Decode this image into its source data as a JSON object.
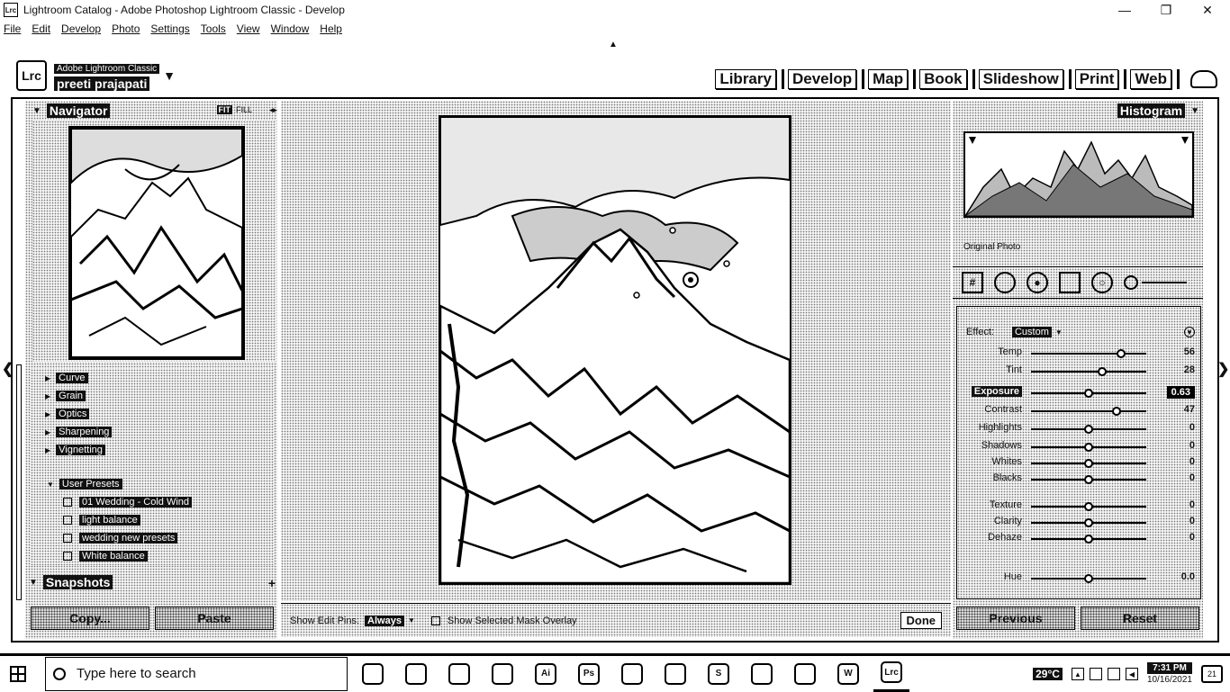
{
  "window": {
    "title": "Lightroom Catalog - Adobe Photoshop Lightroom Classic - Develop",
    "app_icon": "Lrc",
    "controls": {
      "minimize": "—",
      "maximize": "❐",
      "close": "✕"
    }
  },
  "menu": [
    "File",
    "Edit",
    "Develop",
    "Photo",
    "Settings",
    "Tools",
    "View",
    "Window",
    "Help"
  ],
  "identity": {
    "badge": "Lrc",
    "product": "Adobe Lightroom Classic",
    "user": "preeti prajapati"
  },
  "modules": [
    "Library",
    "Develop",
    "Map",
    "Book",
    "Slideshow",
    "Print",
    "Web"
  ],
  "left_panel": {
    "navigator": {
      "title": "Navigator",
      "fit": "FIT",
      "fill": "FILL"
    },
    "preset_groups": [
      {
        "label": "Curve"
      },
      {
        "label": "Grain"
      },
      {
        "label": "Optics"
      },
      {
        "label": "Sharpening"
      },
      {
        "label": "Vignetting"
      }
    ],
    "user_presets": {
      "label": "User Presets",
      "items": [
        "01 Wedding - Cold Wind",
        "light balance",
        "wedding new presets",
        "White balance"
      ]
    },
    "snapshots": {
      "title": "Snapshots"
    },
    "copy_label": "Copy...",
    "paste_label": "Paste"
  },
  "center": {
    "toolbar": {
      "show_label": "Show Edit Pins:",
      "show_value": "Always",
      "overlay_label": "Show Selected Mask Overlay",
      "done_label": "Done"
    }
  },
  "right_panel": {
    "histogram_title": "Histogram",
    "photo_info": "Original Photo",
    "effect_label": "Effect:",
    "effect_value": "Custom",
    "sliders": [
      {
        "label": "Temp",
        "value": "56",
        "level": 0.78,
        "active": false
      },
      {
        "label": "Tint",
        "value": "28",
        "level": 0.62,
        "active": false
      },
      {
        "label": "Exposure",
        "value": "0.63",
        "level": 0.5,
        "active": true
      },
      {
        "label": "Contrast",
        "value": "47",
        "level": 0.74,
        "active": false
      },
      {
        "label": "Highlights",
        "value": "0",
        "level": 0.5,
        "active": false
      },
      {
        "label": "Shadows",
        "value": "0",
        "level": 0.5,
        "active": false
      },
      {
        "label": "Whites",
        "value": "0",
        "level": 0.5,
        "active": false
      },
      {
        "label": "Blacks",
        "value": "0",
        "level": 0.5,
        "active": false
      },
      {
        "label": "Texture",
        "value": "0",
        "level": 0.5,
        "active": false
      },
      {
        "label": "Clarity",
        "value": "0",
        "level": 0.5,
        "active": false
      },
      {
        "label": "Dehaze",
        "value": "0",
        "level": 0.5,
        "active": false
      },
      {
        "label": "Hue",
        "value": "0.0",
        "level": 0.5,
        "active": false
      }
    ],
    "previous_label": "Previous",
    "reset_label": "Reset"
  },
  "taskbar": {
    "search_placeholder": "Type here to search",
    "apps": [
      "obs-icon",
      "film-icon",
      "edge-icon",
      "tablet-icon",
      "ai-icon",
      "ps-icon",
      "chrome-icon",
      "vlc-icon",
      "skype-icon",
      "paint-icon",
      "corel-icon",
      "word-icon",
      "lightroom-icon"
    ],
    "app_labels": [
      "",
      "",
      "",
      "",
      "Ai",
      "Ps",
      "",
      "",
      "S",
      "",
      "",
      "W",
      "Lrc"
    ],
    "weather": "29°C",
    "time": "7:31 PM",
    "date": "10/16/2021",
    "notifications": "21"
  }
}
